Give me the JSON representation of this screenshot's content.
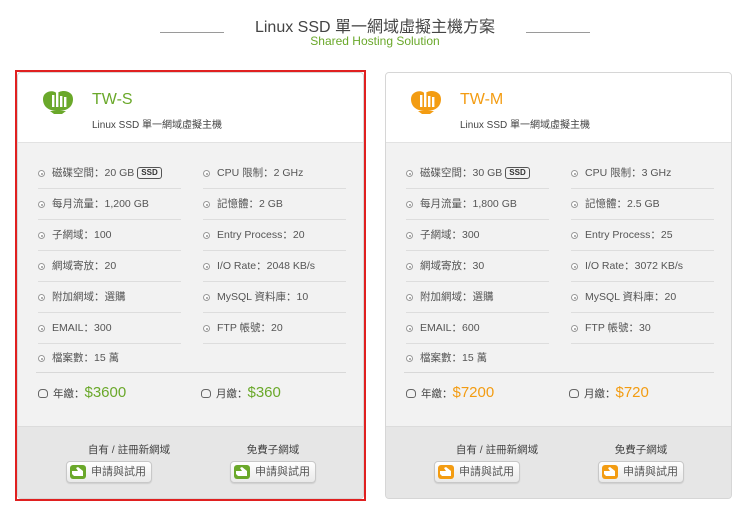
{
  "header": {
    "title": "Linux SSD 單一網域虛擬主機方案",
    "subtitle": "Shared Hosting Solution"
  },
  "colors": {
    "green": "#6aa82a",
    "orange": "#f39c12",
    "selected_border": "#e02020"
  },
  "plans": [
    {
      "name": "TW-S",
      "desc": "Linux SSD 單一網域虛擬主機",
      "accent": "#6aa82a",
      "selected": true,
      "disk": "磁碟空間：20 GB",
      "ssd": "SSD",
      "cpu": "CPU 限制：2 GHz",
      "traffic": "每月流量：1,200 GB",
      "memory": "記憶體：2 GB",
      "subdomain": "子網域：100",
      "entry_process": "Entry Process：20",
      "parked": "網域寄放：20",
      "io_rate": "I/O Rate：2048 KB/s",
      "addon": "附加網域：選購",
      "mysql": "MySQL 資料庫：10",
      "email": "EMAIL：300",
      "ftp": "FTP 帳號：20",
      "files": "檔案數：15 萬",
      "yearly_label": "年繳：",
      "yearly_price": "$3600",
      "monthly_label": "月繳：",
      "monthly_price": "$360",
      "own_domain_label": "自有 / 註冊新網域",
      "free_sub_label": "免費子網域",
      "apply_btn": "申請與試用"
    },
    {
      "name": "TW-M",
      "desc": "Linux SSD 單一網域虛擬主機",
      "accent": "#f39c12",
      "selected": false,
      "disk": "磁碟空間：30 GB",
      "ssd": "SSD",
      "cpu": "CPU 限制：3 GHz",
      "traffic": "每月流量：1,800 GB",
      "memory": "記憶體：2.5 GB",
      "subdomain": "子網域：300",
      "entry_process": "Entry Process：25",
      "parked": "網域寄放：30",
      "io_rate": "I/O Rate：3072 KB/s",
      "addon": "附加網域：選購",
      "mysql": "MySQL 資料庫：20",
      "email": "EMAIL：600",
      "ftp": "FTP 帳號：30",
      "files": "檔案數：15 萬",
      "yearly_label": "年繳：",
      "yearly_price": "$7200",
      "monthly_label": "月繳：",
      "monthly_price": "$720",
      "own_domain_label": "自有 / 註冊新網域",
      "free_sub_label": "免費子網域",
      "apply_btn": "申請與試用"
    }
  ]
}
